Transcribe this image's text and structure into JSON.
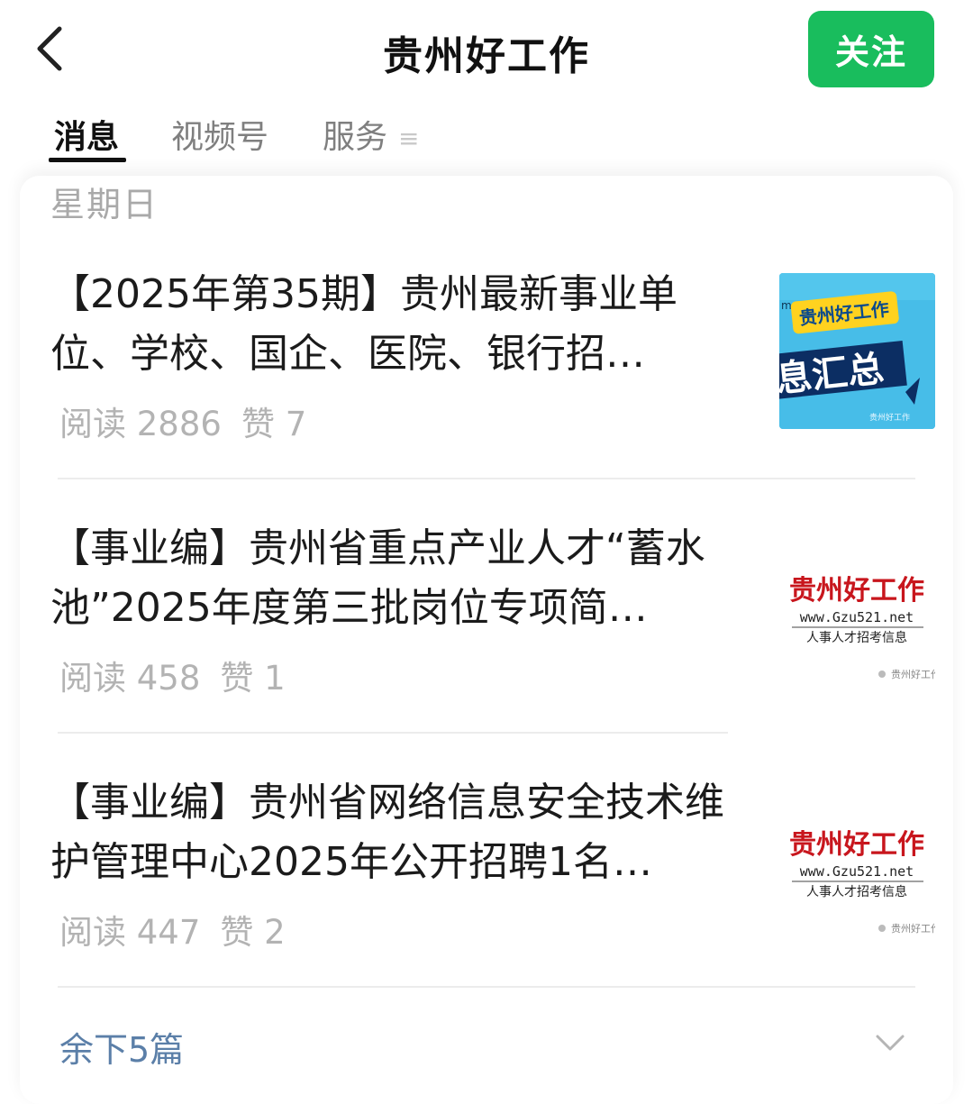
{
  "header": {
    "title": "贵州好工作",
    "follow_label": "关注"
  },
  "tabs": [
    {
      "label": "消息",
      "active": true
    },
    {
      "label": "视频号",
      "active": false
    },
    {
      "label": "服务",
      "active": false
    }
  ],
  "tabs_more_glyph": "≡",
  "feed": {
    "day_label": "星期日",
    "articles": [
      {
        "title": "【2025年第35期】贵州最新事业单位、学校、国企、医院、银行招…",
        "reads": "阅读 2886",
        "likes": "赞 7",
        "thumb": {
          "type": "summary",
          "brand": "贵州好工作",
          "big_text": "息汇总",
          "corner_text": "m",
          "watermark": "贵州好工作"
        }
      },
      {
        "title": "【事业编】贵州省重点产业人才“蓄水池”2025年度第三批岗位专项简…",
        "reads": "阅读 458",
        "likes": "赞 1",
        "thumb": {
          "type": "logo",
          "brand": "贵州好工作",
          "url": "www.Gzu521.net",
          "tagline": "人事人才招考信息",
          "watermark": "贵州好工作"
        }
      },
      {
        "title": "【事业编】贵州省网络信息安全技术维护管理中心2025年公开招聘1名…",
        "reads": "阅读 447",
        "likes": "赞 2",
        "thumb": {
          "type": "logo",
          "brand": "贵州好工作",
          "url": "www.Gzu521.net",
          "tagline": "人事人才招考信息",
          "watermark": "贵州好工作"
        }
      }
    ],
    "remaining_label": "余下5篇"
  },
  "colors": {
    "follow_bg": "#19bd5d",
    "link_blue": "#5b7fa8",
    "meta_gray": "#b3b3b3",
    "logo_red": "#c8161d",
    "thumb_cyan": "#3fb9e6"
  }
}
